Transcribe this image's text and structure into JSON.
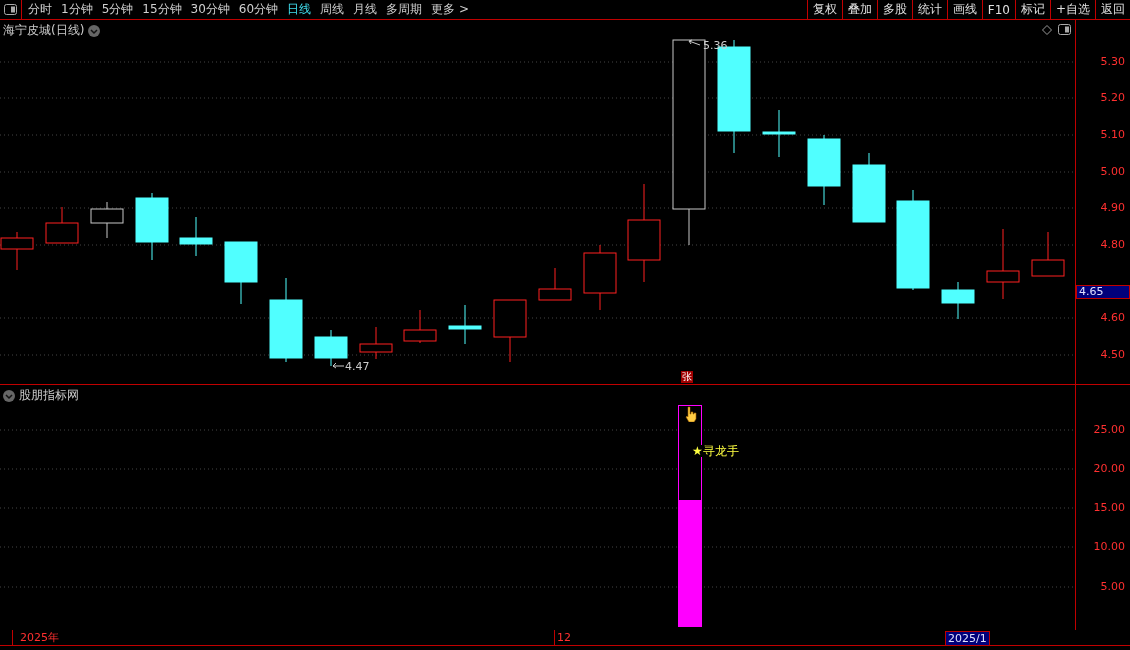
{
  "toolbar": {
    "periods": [
      {
        "label": "分时",
        "selected": false
      },
      {
        "label": "1分钟",
        "selected": false
      },
      {
        "label": "5分钟",
        "selected": false
      },
      {
        "label": "15分钟",
        "selected": false
      },
      {
        "label": "30分钟",
        "selected": false
      },
      {
        "label": "60分钟",
        "selected": false
      },
      {
        "label": "日线",
        "selected": true
      },
      {
        "label": "周线",
        "selected": false
      },
      {
        "label": "月线",
        "selected": false
      },
      {
        "label": "多周期",
        "selected": false
      },
      {
        "label": "更多 >",
        "selected": false
      }
    ],
    "actions": [
      "复权",
      "叠加",
      "多股",
      "统计",
      "画线",
      "F10",
      "标记",
      "+自选",
      "返回"
    ]
  },
  "main_pane": {
    "title": "海宁皮城(日线)",
    "price_ticks": [
      "5.30",
      "5.20",
      "5.10",
      "5.00",
      "4.90",
      "4.80",
      "4.60",
      "4.50"
    ],
    "current_price": "4.65",
    "high_label": "5.36",
    "low_label": "4.47",
    "marker": "张"
  },
  "indicator_pane": {
    "title": "股朋指标网",
    "ticks": [
      "25.00",
      "20.00",
      "15.00",
      "10.00",
      "5.00"
    ],
    "signal_label": "★寻龙手"
  },
  "time_axis": {
    "labels": [
      "2025年",
      "12"
    ],
    "current": "2025/1"
  }
}
